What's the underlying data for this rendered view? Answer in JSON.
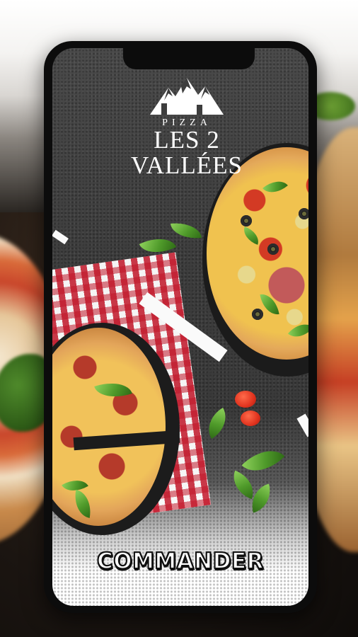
{
  "brand": {
    "small_text": "PIZZA",
    "name": "LES 2 VALLÉES"
  },
  "cta": {
    "label": "COMMANDER"
  },
  "colors": {
    "background": "#3d3d3d",
    "cta_text": "#ffffff",
    "cta_outline": "#111111",
    "tablecloth_red": "#c81428"
  },
  "icons": [
    "mountains-logo-icon"
  ]
}
